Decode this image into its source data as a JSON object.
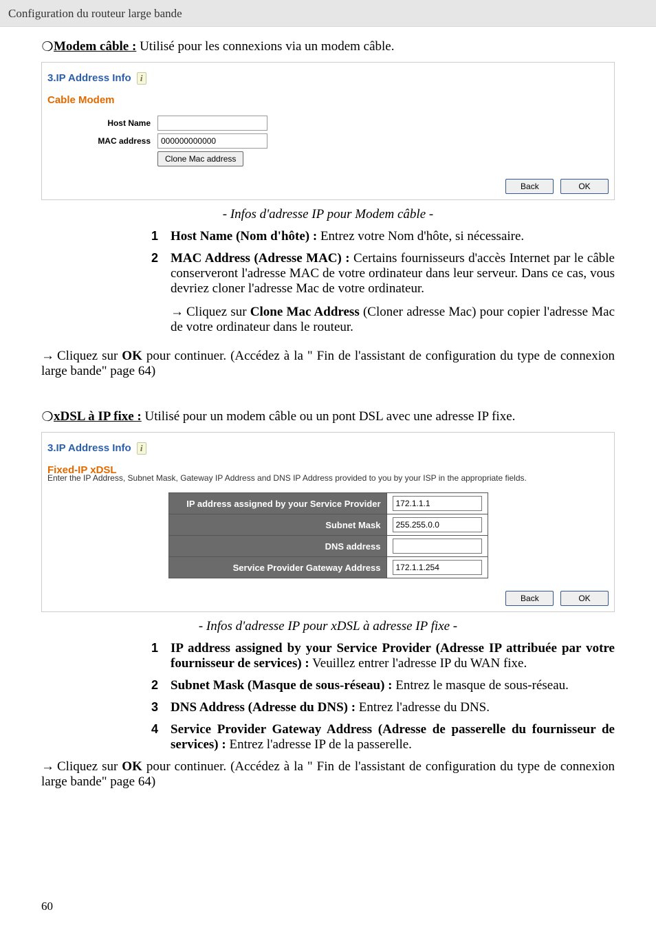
{
  "header": {
    "title": "Configuration du routeur large bande"
  },
  "modem_cable_bullet": {
    "label": "Modem câble :",
    "text": "Utilisé pour les connexions via un modem câble."
  },
  "pane1": {
    "title": "3.IP Address Info",
    "subtitle": "Cable Modem",
    "host_name_label": "Host Name",
    "host_name_value": "",
    "mac_label": "MAC address",
    "mac_value": "000000000000",
    "clone_btn": "Clone Mac address",
    "back_btn": "Back",
    "ok_btn": "OK"
  },
  "caption1": "- Infos d'adresse IP pour Modem câble -",
  "list1": [
    {
      "n": "1",
      "bold": "Host Name (Nom d'hôte) :",
      "rest": " Entrez votre Nom d'hôte, si nécessaire."
    },
    {
      "n": "2",
      "bold": "MAC Address (Adresse MAC) :",
      "rest": " Certains fournisseurs d'accès Internet par le câble conserveront l'adresse MAC de votre ordinateur dans leur serveur. Dans ce cas, vous devriez cloner l'adresse Mac de votre ordinateur."
    }
  ],
  "clone_note": {
    "pre": "Cliquez sur ",
    "bold": "Clone Mac Address",
    "post": " (Cloner adresse Mac) pour copier l'adresse Mac de votre ordinateur dans le routeur."
  },
  "ok_note": {
    "pre": "Cliquez sur ",
    "bold": "OK",
    "post": " pour continuer. (Accédez à la \" Fin de l'assistant de configuration du type de connexion large bande\" page 64)"
  },
  "xdsl_bullet": {
    "label": "xDSL à IP fixe :",
    "text": "Utilisé pour un modem câble ou un pont DSL avec une adresse IP fixe."
  },
  "pane2": {
    "title": "3.IP Address Info",
    "subtitle": "Fixed-IP xDSL",
    "desc": "Enter the IP Address, Subnet Mask, Gateway IP Address and DNS IP Address provided to you by your ISP in the appropriate fields.",
    "rows": [
      {
        "label": "IP address assigned by your Service Provider",
        "value": "172.1.1.1"
      },
      {
        "label": "Subnet Mask",
        "value": "255.255.0.0"
      },
      {
        "label": "DNS address",
        "value": ""
      },
      {
        "label": "Service Provider Gateway Address",
        "value": "172.1.1.254"
      }
    ],
    "back_btn": "Back",
    "ok_btn": "OK"
  },
  "caption2": "- Infos d'adresse IP pour xDSL à adresse IP fixe -",
  "list2": [
    {
      "n": "1",
      "bold": "IP address assigned by your Service Provider (Adresse IP attribuée par votre fournisseur de services) :",
      "rest": " Veuillez entrer l'adresse IP du WAN fixe."
    },
    {
      "n": "2",
      "bold": "Subnet Mask (Masque de sous-réseau) :",
      "rest": " Entrez le masque de sous-réseau."
    },
    {
      "n": "3",
      "bold": "DNS Address (Adresse du DNS) :",
      "rest": " Entrez l'adresse du DNS."
    },
    {
      "n": "4",
      "bold": "Service Provider Gateway Address (Adresse de passerelle du fournisseur de services) :",
      "rest": " Entrez l'adresse IP de la passerelle."
    }
  ],
  "page_number": "60"
}
